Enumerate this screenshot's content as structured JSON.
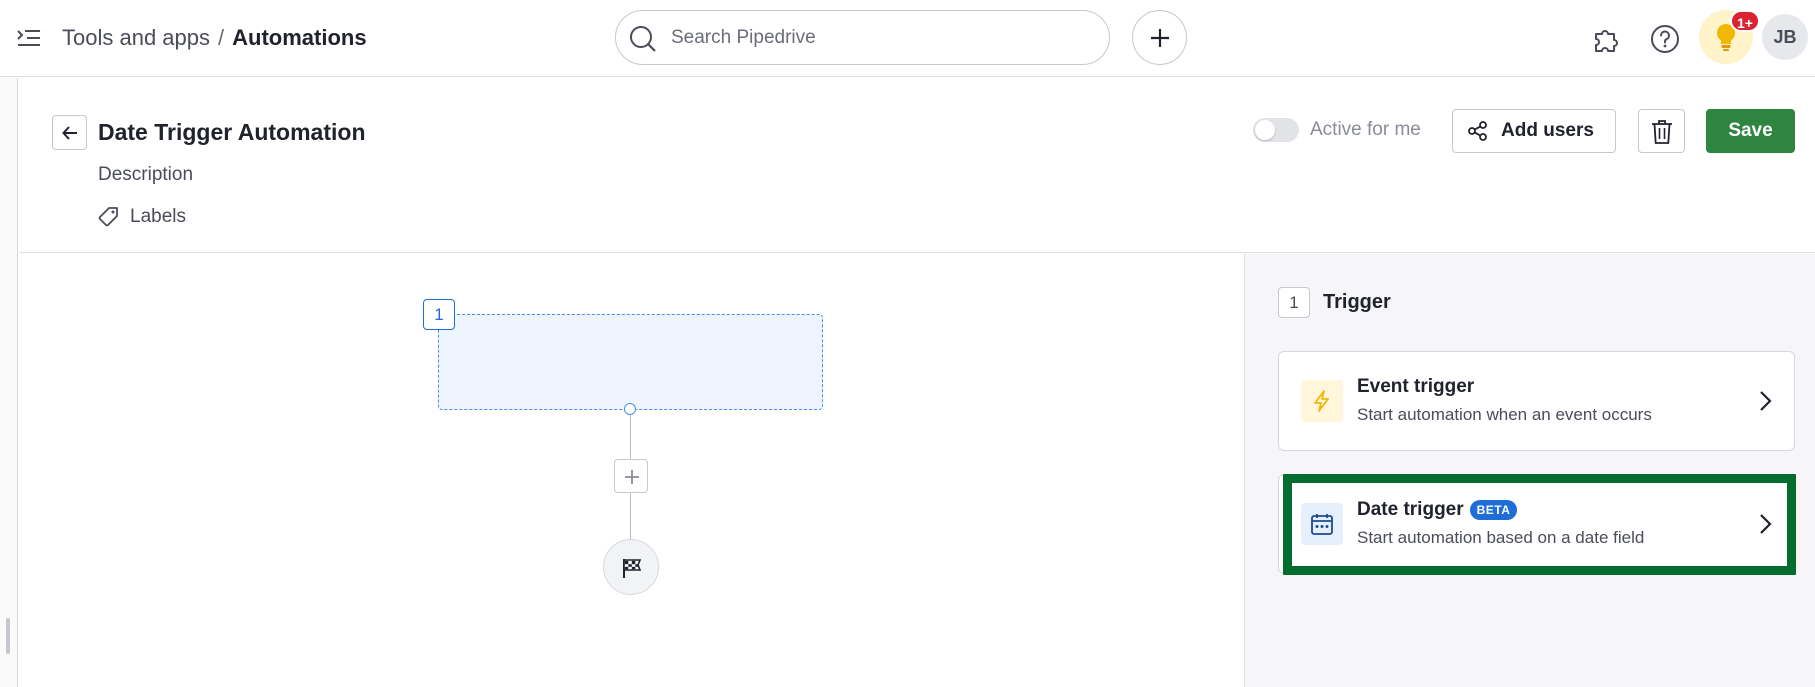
{
  "breadcrumb": {
    "parent": "Tools and apps",
    "separator": "/",
    "current": "Automations"
  },
  "search": {
    "placeholder": "Search Pipedrive"
  },
  "notifications": {
    "badge": "1+"
  },
  "user": {
    "initials": "JB"
  },
  "automation": {
    "title": "Date Trigger Automation",
    "description_placeholder": "Description",
    "labels_label": "Labels",
    "active_toggle_label": "Active for me",
    "active": false,
    "add_users_label": "Add users",
    "save_label": "Save"
  },
  "canvas": {
    "step_number": "1"
  },
  "panel": {
    "step_number": "1",
    "title": "Trigger",
    "options": [
      {
        "name": "Event trigger",
        "description": "Start automation when an event occurs",
        "icon": "lightning-icon"
      },
      {
        "name": "Date trigger",
        "badge": "BETA",
        "description": "Start automation based on a date field",
        "icon": "calendar-icon"
      }
    ]
  },
  "colors": {
    "primary_green": "#2e8540",
    "accent_blue": "#1f6dd6",
    "highlight_green": "#036d2f",
    "badge_red": "#d9232f"
  }
}
